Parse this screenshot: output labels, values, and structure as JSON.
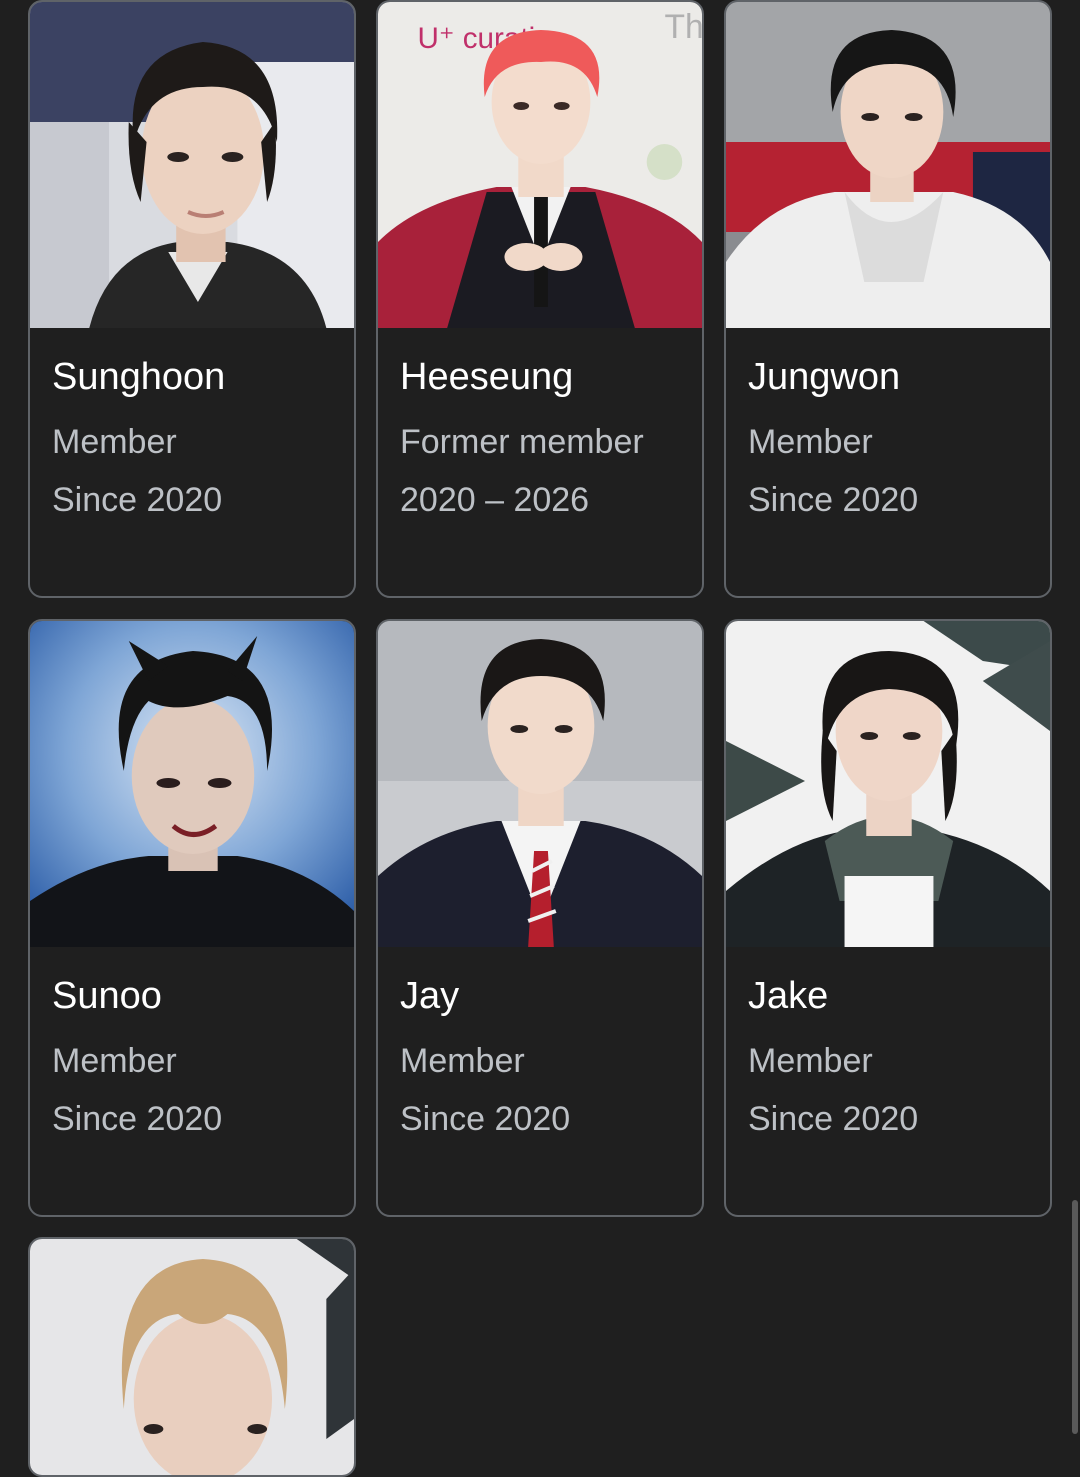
{
  "members": [
    {
      "name": "Sunghoon",
      "role": "Member",
      "years": "Since 2020",
      "photo": "portrait-photo-dark-hair-leather-jacket"
    },
    {
      "name": "Heeseung",
      "role": "Former member",
      "years": "2020 – 2026",
      "photo": "portrait-photo-red-hair-varsity-jacket"
    },
    {
      "name": "Jungwon",
      "role": "Member",
      "years": "Since 2020",
      "photo": "portrait-photo-white-hooded-jacket"
    },
    {
      "name": "Sunoo",
      "role": "Member",
      "years": "Since 2020",
      "photo": "portrait-photo-blue-background"
    },
    {
      "name": "Jay",
      "role": "Member",
      "years": "Since 2020",
      "photo": "portrait-photo-school-uniform"
    },
    {
      "name": "Jake",
      "role": "Member",
      "years": "Since 2020",
      "photo": "portrait-photo-green-jacket"
    },
    {
      "photo": "portrait-photo-blonde-hair"
    }
  ],
  "photo_text": {
    "banner": "U⁺ curative",
    "corner": "Th"
  },
  "colors": {
    "background": "#1f1f1f",
    "card_border": "#5f6368",
    "name_text": "#ffffff",
    "secondary_text": "#bdc1c6"
  }
}
